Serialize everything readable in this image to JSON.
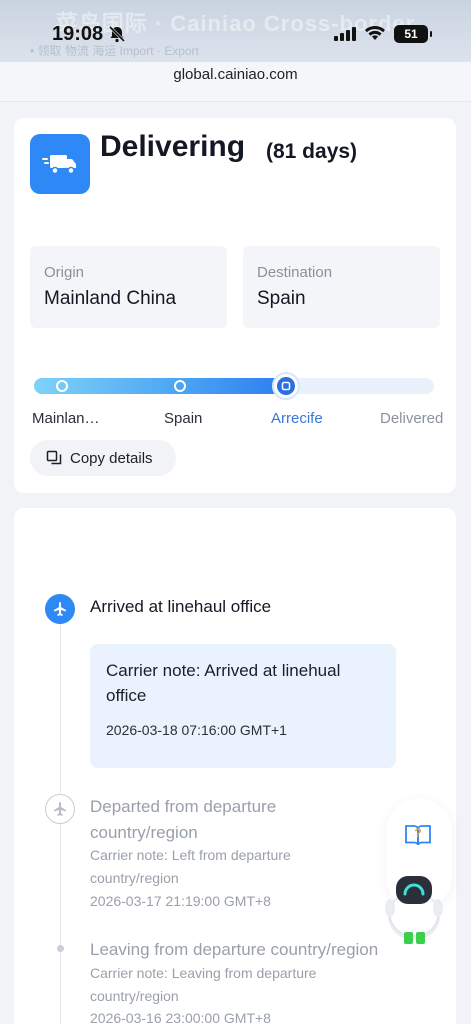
{
  "status_bar": {
    "time": "19:08",
    "battery": "51",
    "icons": [
      "bell-off-icon",
      "signal-icon",
      "wifi-icon",
      "battery-icon"
    ]
  },
  "background_ghost": {
    "title": "菜鸟国际 · Cainiao Cross-border",
    "subtitle": "• 领取  物流  海运   Import · Export"
  },
  "browser": {
    "url": "global.cainiao.com"
  },
  "shipment": {
    "status": "Delivering",
    "days": "(81 days)",
    "origin_label": "Origin",
    "origin_value": "Mainland China",
    "destination_label": "Destination",
    "destination_value": "Spain",
    "progress_fraction": 0.63,
    "steps": [
      {
        "label": "Mainlan…",
        "state": "done"
      },
      {
        "label": "Spain",
        "state": "done"
      },
      {
        "label": "Arrecife",
        "state": "current"
      },
      {
        "label": "Delivered",
        "state": "future"
      }
    ],
    "copy_button": "Copy details",
    "accent_color": "#2e88f5"
  },
  "events": [
    {
      "title": "Arrived at linehaul office",
      "note": "Carrier note: Arrived at linehual office",
      "time": "2026-03-18 07:16:00 GMT+1",
      "icon": "airplane-icon"
    },
    {
      "title": "Departed from departure country/region",
      "note": "Carrier note: Left from departure country/region",
      "time": "2026-03-17 21:19:00 GMT+8",
      "icon": "airplane-icon"
    },
    {
      "title": "Leaving from departure country/region",
      "note": "Carrier note: Leaving from departure country/region",
      "time": "2026-03-16 23:00:00 GMT+8",
      "icon": "dot-icon"
    }
  ],
  "assistant": {
    "help_icon": "help-book-icon",
    "mascot": "robot-mascot-icon"
  }
}
